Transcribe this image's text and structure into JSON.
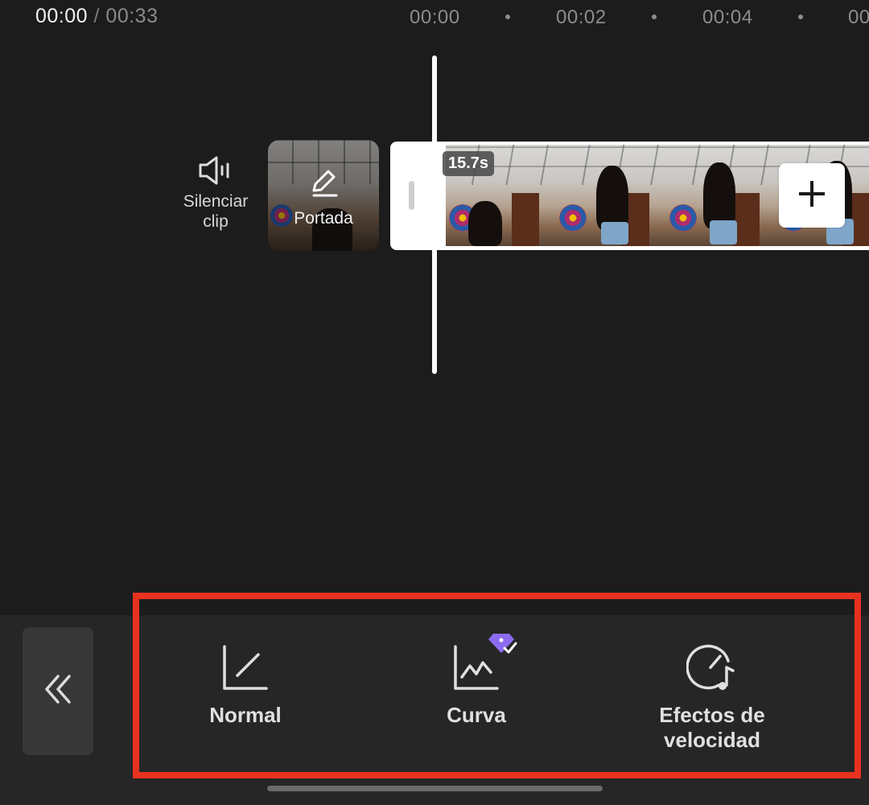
{
  "timebar": {
    "current": "00:00",
    "separator": "/",
    "total": "00:33",
    "ticks": [
      "00:00",
      "00:02",
      "00:04",
      "00"
    ]
  },
  "mute": {
    "label": "Silenciar clip",
    "icon": "speaker-icon"
  },
  "cover": {
    "label": "Portada",
    "icon": "pencil-icon"
  },
  "clip": {
    "duration": "15.7s",
    "add_icon": "plus-icon"
  },
  "speed_options": [
    {
      "label": "Normal",
      "icon": "linear-speed-icon"
    },
    {
      "label": "Curva",
      "icon": "curve-speed-icon",
      "badge_icon": "premium-diamond-icon",
      "badge_color": "#8b6cf0"
    },
    {
      "label": "Efectos de velocidad",
      "icon": "speed-effects-icon"
    }
  ],
  "back_icon": "double-chevron-left-icon",
  "colors": {
    "background": "#1c1c1c",
    "panel": "#262626",
    "highlight": "#e8321f"
  }
}
